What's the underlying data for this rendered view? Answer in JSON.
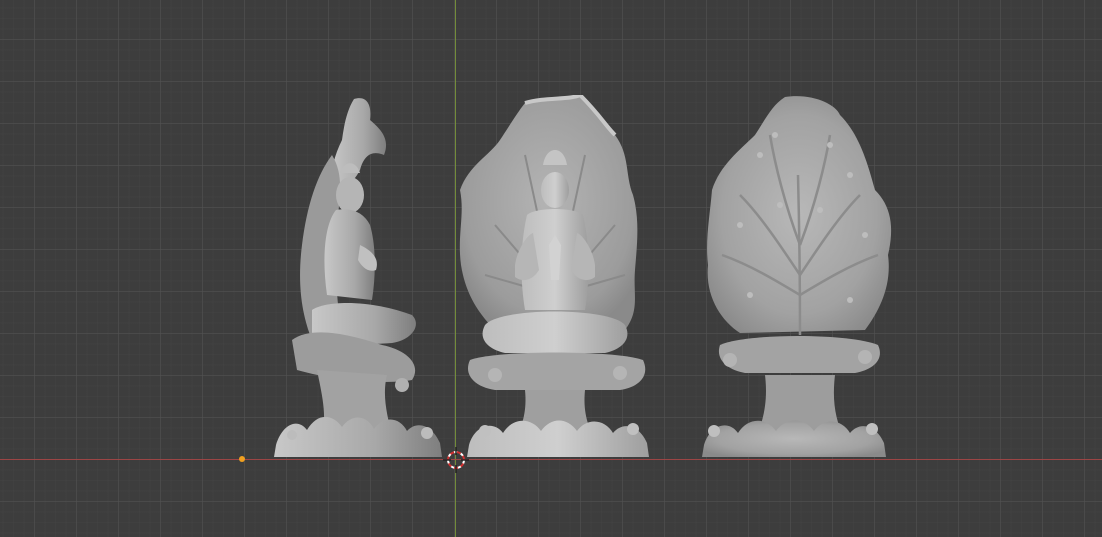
{
  "viewport": {
    "background_color": "#3d3d3d",
    "grid_color": "#525252",
    "x_axis_color": "#a54545",
    "y_axis_color": "#7d9a3a",
    "origin_color": "#f0a020",
    "model_color": "#a8a8a8",
    "cursor_icon": "3d-cursor-icon"
  },
  "objects": [
    {
      "name": "statue-side-view",
      "icon": "guanyin-side-icon"
    },
    {
      "name": "statue-front-view",
      "icon": "guanyin-front-icon"
    },
    {
      "name": "statue-back-view",
      "icon": "guanyin-back-icon"
    }
  ]
}
